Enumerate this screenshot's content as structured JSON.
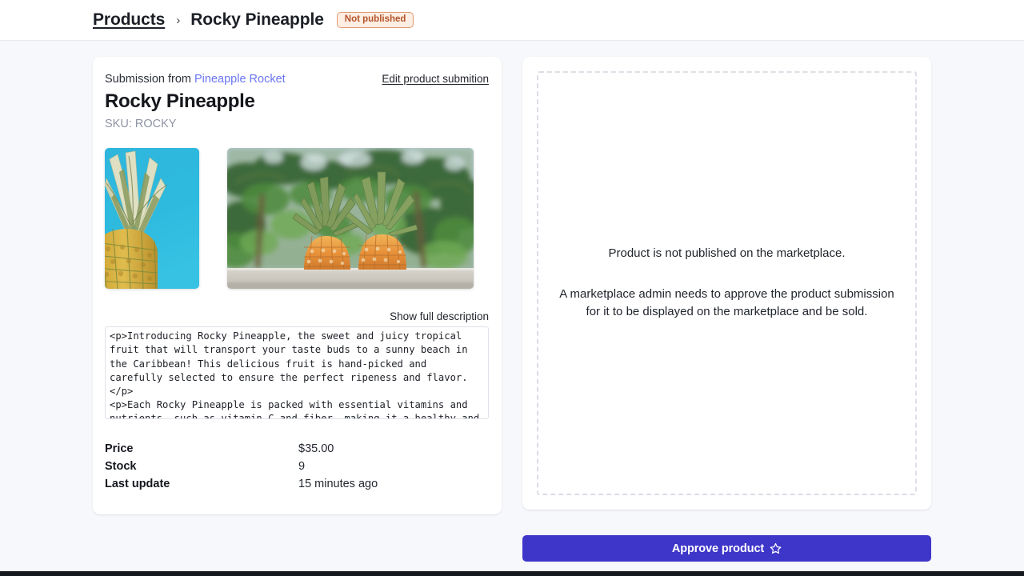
{
  "breadcrumb": {
    "parent": "Products",
    "separator": "›",
    "current": "Rocky Pineapple",
    "status_badge": "Not published",
    "badge_text_color": "#b5542a",
    "badge_bg_color": "#fdeee3",
    "badge_border_color": "#e09a6e"
  },
  "submission": {
    "from_label": "Submission from",
    "vendor": "Pineapple Rocket",
    "vendor_color": "#6b76f2",
    "edit_link": "Edit product submition",
    "product_title": "Rocky Pineapple",
    "sku": "SKU: ROCKY"
  },
  "gallery": {
    "images": [
      {
        "name": "pineapple-on-blue-sky",
        "alt": "Pineapple against a bright blue sky"
      },
      {
        "name": "two-pineapples-palm-trees",
        "alt": "Two pineapples on a ledge in front of palm trees"
      }
    ]
  },
  "description": {
    "toggle_label": "Show full description",
    "body": "<p>Introducing Rocky Pineapple, the sweet and juicy tropical fruit that will transport your taste buds to a sunny beach in the Caribbean! This delicious fruit is hand-picked and carefully selected to ensure the perfect ripeness and flavor.</p>\n<p>Each Rocky Pineapple is packed with essential vitamins and nutrients, such as vitamin C and fiber, making it a healthy and delicious addition to any diet. Whether you are enjoying it on its own,"
  },
  "details": {
    "rows": [
      {
        "label": "Price",
        "value": "$35.00"
      },
      {
        "label": "Stock",
        "value": "9"
      },
      {
        "label": "Last update",
        "value": "15 minutes ago"
      }
    ]
  },
  "publish_panel": {
    "line1": "Product is not published on the marketplace.",
    "line2": "A marketplace admin needs to approve the product submission for it to be displayed on the marketplace and be sold."
  },
  "actions": {
    "approve_label": "Approve product",
    "approve_icon": "star-outline-icon",
    "approve_color": "#3e35c9"
  }
}
